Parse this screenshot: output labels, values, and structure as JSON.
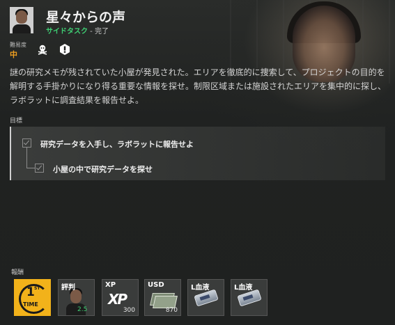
{
  "quest": {
    "title": "星々からの声",
    "type": "サイドタスク",
    "separator": " - ",
    "status": "完了"
  },
  "difficulty": {
    "label": "難易度",
    "value": "中",
    "icons": [
      "skull-crossbones-icon",
      "exclamation-icon"
    ]
  },
  "description": "謎の研究メモが残されていた小屋が発見された。エリアを徹底的に捜索して、プロジェクトの目的を解明する手掛かりになり得る重要な情報を探せ。制限区域または施設されたエリアを集中的に探し、ラボラットに調査結果を報告せよ。",
  "objectives": {
    "label": "目標",
    "items": [
      {
        "text": "研究データを入手し、ラボラットに報告せよ",
        "done": true
      },
      {
        "text": "小屋の中で研究データを探せ",
        "done": true
      }
    ]
  },
  "rewards": {
    "label": "報酬",
    "items": [
      {
        "name": "1st time",
        "icon": "first-time-icon",
        "ft_num": "1",
        "ft_suffix": "ST",
        "ft_word": "TIME"
      },
      {
        "name": "評判",
        "icon": "reputation-portrait-icon",
        "qty": "2.5"
      },
      {
        "name": "XP",
        "icon": "xp-icon",
        "qty": "300",
        "glyph": "XP"
      },
      {
        "name": "USD",
        "icon": "cash-icon",
        "qty": "870"
      },
      {
        "name": "L血液",
        "icon": "blood-bag-icon"
      },
      {
        "name": "L血液",
        "icon": "blood-bag-icon"
      }
    ]
  },
  "colors": {
    "accent_green": "#3fd174",
    "difficulty_orange": "#f0a020",
    "first_time_yellow": "#f2b21a"
  }
}
